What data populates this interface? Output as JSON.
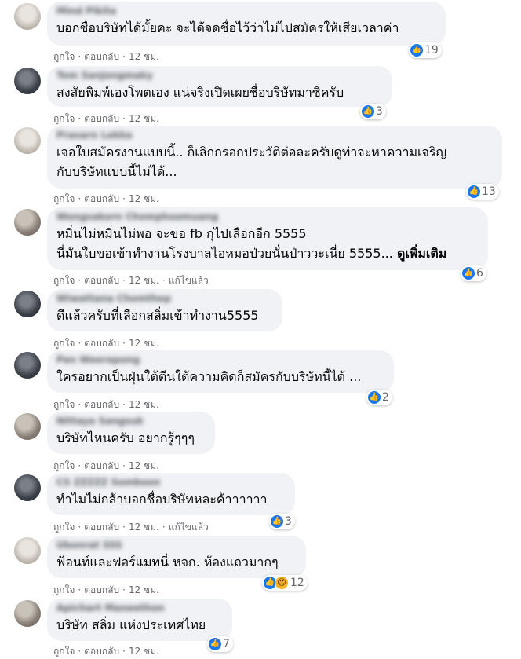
{
  "actions": {
    "like": "ถูกใจ",
    "reply": "ตอบกลับ",
    "edited": "แก้ไขแล้ว"
  },
  "comments": [
    {
      "name": "Mind Pikita",
      "lines": [
        "บอกชื่อบริษัทได้มั้ยคะ จะได้จดชื่อไว้ว่าไม่ไปสมัครให้เสียเวลาค่า"
      ],
      "time": "12 ชม.",
      "likes": "19",
      "reaction_icon": "like-icon"
    },
    {
      "name": "Tom Sanjongmaky",
      "lines": [
        "สงสัยพิมพ์เองโพตเอง แน่จริงเปิดเผยชื่อบริษัทมาซิครับ"
      ],
      "time": "12 ชม.",
      "likes": "3",
      "reaction_icon": "like-icon"
    },
    {
      "name": "Prasarn Lekka",
      "lines": [
        "เจอใบสมัครงานแบบนี้.. ก็เลิกกรอกประวัติต่อละครับดูท่าจะหาความเจริญ",
        "กับบริษัทแบบนี้ไม่ได้..."
      ],
      "time": "12 ชม.",
      "likes": "13",
      "reaction_icon": "like-icon"
    },
    {
      "name": "Wongsakorn Chomphoomuang",
      "lines": [
        "หมิ่นไม่หมิ่นไม่พอ จะขอ fb กุไปเลือกอีก 5555",
        "นี่มันใบขอเข้าทำงานโรงบาลไอหมอป่วยนั่นป่าววะเนี่ย 5555..."
      ],
      "see_more": "ดูเพิ่มเติม",
      "time": "12 ชม.",
      "edited": true,
      "likes": "6",
      "reaction_icon": "like-icon"
    },
    {
      "name": "Wiwattana Chomthep",
      "lines": [
        "ดีแล้วครับที่เลือกสลิ่มเข้าทำงาน5555"
      ],
      "time": "12 ชม."
    },
    {
      "name": "Pan Weerapong",
      "lines": [
        "ใครอยากเป็นฝุ่นใต้ตีนใต้ความคิดก็สมัครกับบริษัทนี้ได้ ..."
      ],
      "time": "12 ชม.",
      "likes": "2",
      "reaction_icon": "like-icon"
    },
    {
      "name": "Nittaya Sangsuk",
      "lines": [
        "บริษัทไหนครับ อยากรู้ๆๆๆ"
      ],
      "time": "12 ชม."
    },
    {
      "name": "CS ZZZZZ Somboon",
      "lines": [
        "ทำไมไม่กล้าบอกชื่อบริษัทหละค้าาาาาา"
      ],
      "time": "12 ชม.",
      "edited": true,
      "likes": "3",
      "reaction_icon": "like-icon"
    },
    {
      "name": "Ubonrat SSS",
      "lines": [
        "ฟ้อนท์และฟอร์แมทนี่ หจก. ห้องแถวมากๆ"
      ],
      "time": "12 ชม.",
      "likes": "12",
      "reaction_icon": "like-icon",
      "reaction_icon_2": "haha-icon"
    },
    {
      "name": "Apichart Maneethon",
      "lines": [
        "บริษัท สลิ่ม แห่งประเทศไทย"
      ],
      "time": "12 ชม.",
      "likes": "7",
      "reaction_icon": "like-icon"
    }
  ]
}
